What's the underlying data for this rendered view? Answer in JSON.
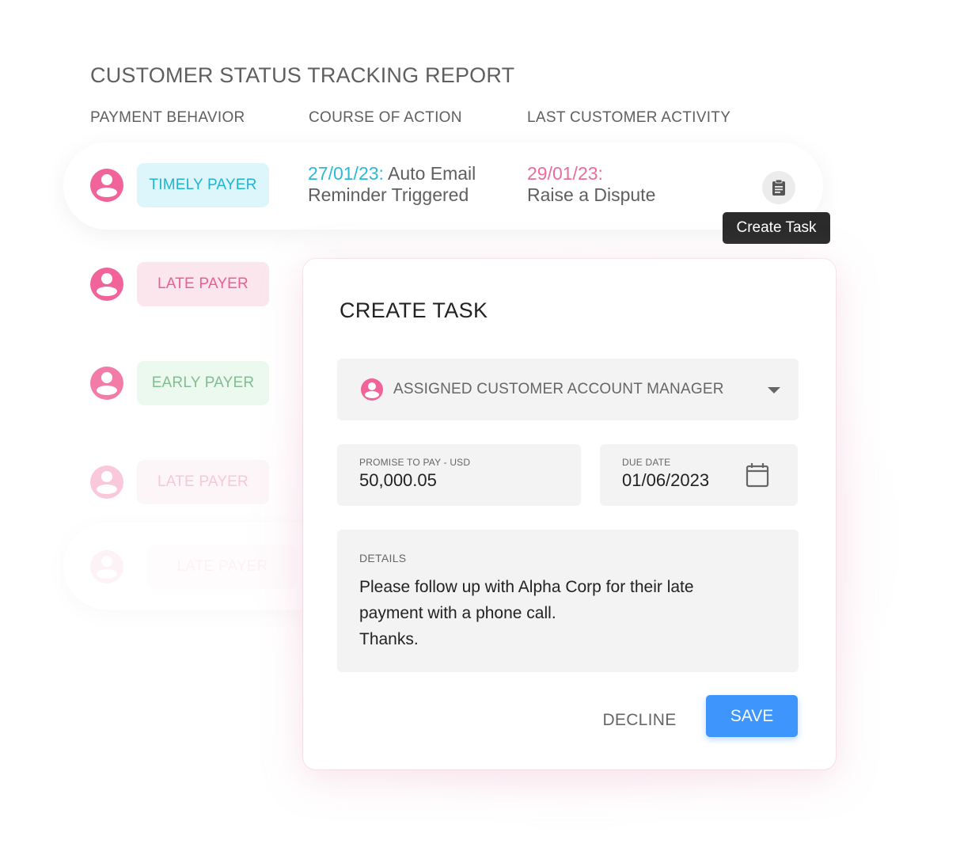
{
  "report": {
    "title": "CUSTOMER STATUS TRACKING REPORT",
    "columns": [
      "PAYMENT BEHAVIOR",
      "COURSE OF ACTION",
      "LAST CUSTOMER ACTIVITY"
    ]
  },
  "rows": [
    {
      "status": "TIMELY PAYER",
      "action_date": "27/01/23:",
      "action_text": "Auto Email Reminder Triggered",
      "activity_date": "29/01/23:",
      "activity_text": "Raise a Dispute"
    },
    {
      "status": "LATE PAYER"
    },
    {
      "status": "EARLY PAYER"
    },
    {
      "status": "LATE PAYER"
    },
    {
      "status": "LATE PAYER"
    }
  ],
  "task_icon": "clipboard-icon",
  "tooltip": "Create Task",
  "colors": {
    "accent_pink": "#f0649a",
    "timely_cyan": "#22b3cf",
    "late_pink": "#ec5d94",
    "early_green": "#6db27f",
    "save_blue": "#3e95fb"
  },
  "modal": {
    "title": "CREATE TASK",
    "assignee_select": {
      "value": "ASSIGNED CUSTOMER ACCOUNT MANAGER",
      "icon": "user-avatar-icon"
    },
    "amount": {
      "label": "PROMISE TO PAY - USD",
      "value": "50,000.05"
    },
    "due_date": {
      "label": "DUE DATE",
      "value": "01/06/2023",
      "icon": "calendar-icon"
    },
    "details": {
      "label": "DETAILS",
      "value": "Please follow up with Alpha Corp for their late\npayment with a phone call.\nThanks."
    },
    "decline_label": "DECLINE",
    "save_label": "SAVE"
  }
}
